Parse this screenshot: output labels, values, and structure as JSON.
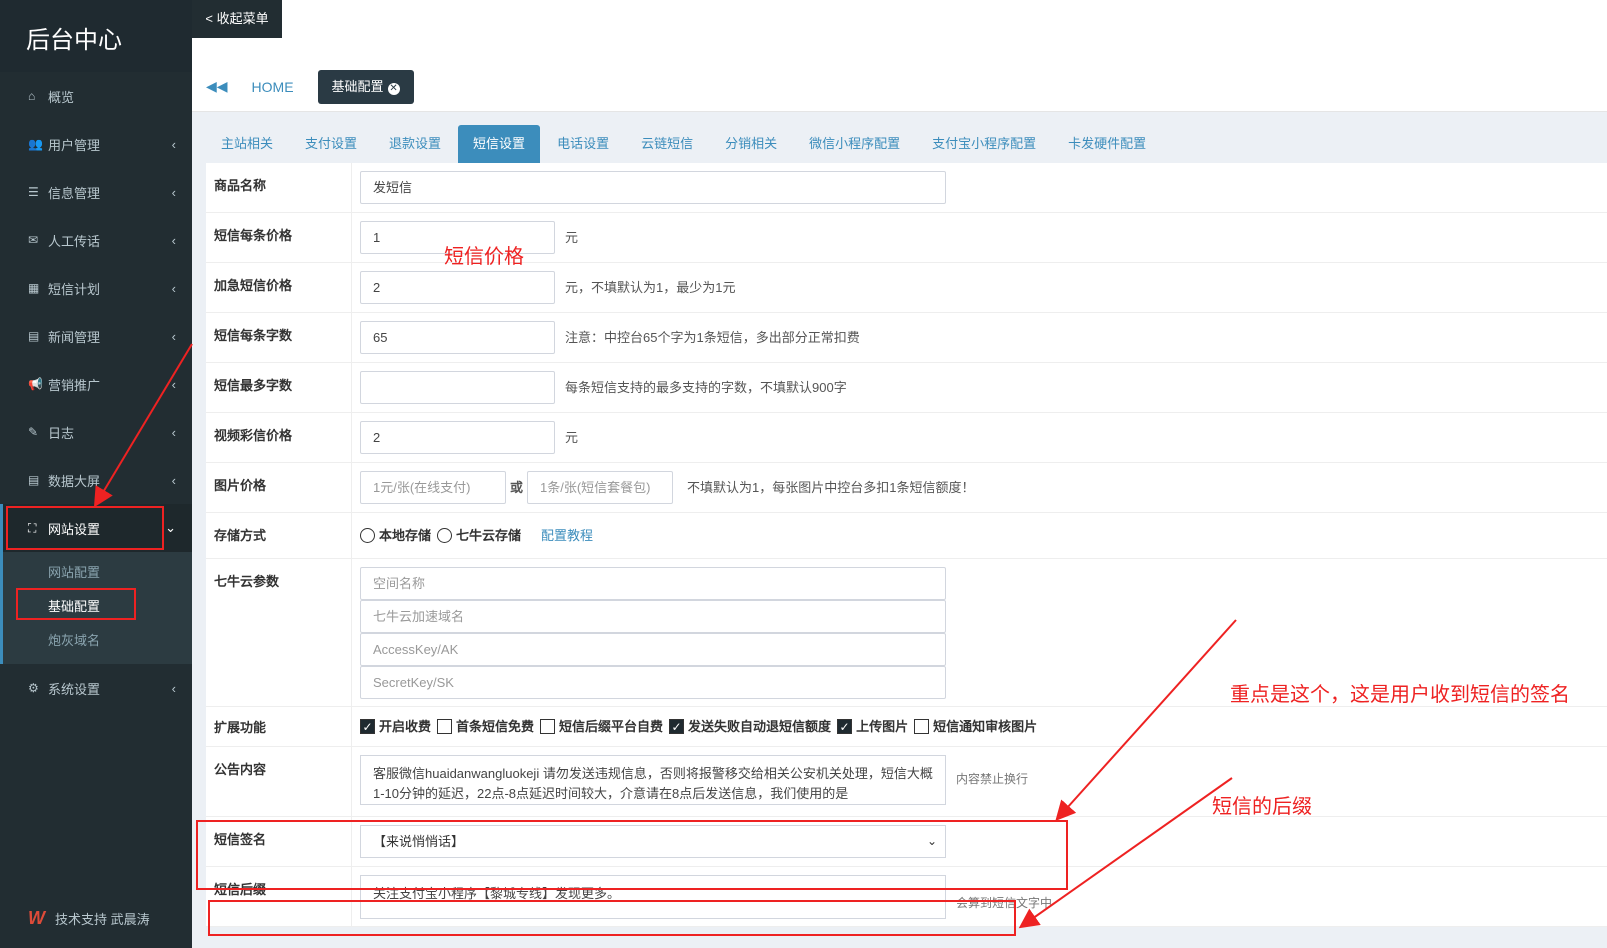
{
  "sidebar": {
    "brand": "后台中心",
    "items": [
      {
        "label": "概览",
        "icon": "⌂"
      },
      {
        "label": "用户管理",
        "icon": "👥"
      },
      {
        "label": "信息管理",
        "icon": "☰"
      },
      {
        "label": "人工传话",
        "icon": "✉"
      },
      {
        "label": "短信计划",
        "icon": "▦"
      },
      {
        "label": "新闻管理",
        "icon": "▤"
      },
      {
        "label": "营销推广",
        "icon": "📢"
      },
      {
        "label": "日志",
        "icon": "✎"
      },
      {
        "label": "数据大屏",
        "icon": "▤"
      },
      {
        "label": "网站设置",
        "icon": "⛶"
      },
      {
        "label": "系统设置",
        "icon": "⚙"
      }
    ],
    "submenu": [
      "网站配置",
      "基础配置",
      "炮灰域名"
    ],
    "footer": "技术支持 武晨涛"
  },
  "topbar": {
    "collapse": "< 收起菜单",
    "home": "HOME",
    "active_tab": "基础配置"
  },
  "tabs": [
    "主站相关",
    "支付设置",
    "退款设置",
    "短信设置",
    "电话设置",
    "云链短信",
    "分销相关",
    "微信小程序配置",
    "支付宝小程序配置",
    "卡发硬件配置"
  ],
  "form": {
    "goods_name": {
      "label": "商品名称",
      "value": "发短信"
    },
    "sms_price": {
      "label": "短信每条价格",
      "value": "1",
      "unit": "元"
    },
    "urgent_price": {
      "label": "加急短信价格",
      "value": "2",
      "hint": "元，不填默认为1，最少为1元"
    },
    "sms_chars": {
      "label": "短信每条字数",
      "value": "65",
      "hint": "注意：中控台65个字为1条短信，多出部分正常扣费"
    },
    "sms_max": {
      "label": "短信最多字数",
      "value": "",
      "hint": "每条短信支持的最多支持的字数，不填默认900字"
    },
    "video_price": {
      "label": "视频彩信价格",
      "value": "2",
      "unit": "元"
    },
    "image_price": {
      "label": "图片价格",
      "ph1": "1元/张(在线支付)",
      "or": "或",
      "ph2": "1条/张(短信套餐包)",
      "hint": "不填默认为1，每张图片中控台多扣1条短信额度！"
    },
    "storage": {
      "label": "存储方式",
      "opt1": "本地存储",
      "opt2": "七牛云存储",
      "link": "配置教程"
    },
    "qiniu": {
      "label": "七牛云参数",
      "ph": [
        "空间名称",
        "七牛云加速域名",
        "AccessKey/AK",
        "SecretKey/SK"
      ]
    },
    "ext": {
      "label": "扩展功能",
      "options": [
        {
          "label": "开启收费",
          "checked": true
        },
        {
          "label": "首条短信免费",
          "checked": false
        },
        {
          "label": "短信后缀平台自费",
          "checked": false
        },
        {
          "label": "发送失败自动退短信额度",
          "checked": true
        },
        {
          "label": "上传图片",
          "checked": true
        },
        {
          "label": "短信通知审核图片",
          "checked": false
        }
      ]
    },
    "notice": {
      "label": "公告内容",
      "text": "客服微信huaidanwangluokeji  请勿发送违规信息，否则将报警移交给相关公安机关处理，短信大概1-10分钟的延迟，22点-8点延迟时间较大，介意请在8点后发送信息，我们使用的是",
      "hint": "内容禁止换行"
    },
    "signature": {
      "label": "短信签名",
      "value": "【来说悄悄话】"
    },
    "suffix": {
      "label": "短信后缀",
      "value": "关注支付宝小程序【黎城专线】发现更多。",
      "hint": "会算到短信文字中"
    }
  },
  "annotations": {
    "price_note": "短信价格",
    "signature_note": "重点是这个，这是用户收到短信的签名",
    "suffix_note": "短信的后缀"
  }
}
